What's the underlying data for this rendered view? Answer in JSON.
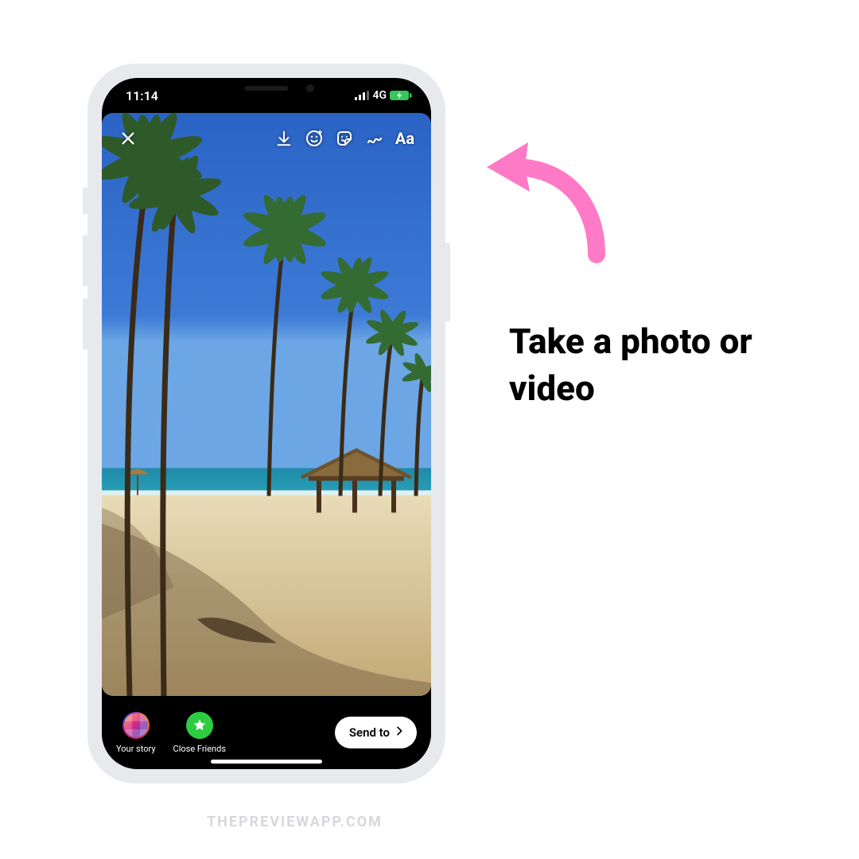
{
  "status": {
    "time": "11:14",
    "network": "4G"
  },
  "topbar": {
    "text_tool": "Aa"
  },
  "bottombar": {
    "your_story": "Your story",
    "close_friends": "Close Friends",
    "send_to": "Send to"
  },
  "annotation": {
    "caption": "Take a photo or video",
    "arrow_color": "#ff7ac6"
  },
  "watermark": "THEPREVIEWAPP.COM",
  "colors": {
    "close_friends_green": "#2ecc40",
    "battery_green": "#34c759"
  }
}
